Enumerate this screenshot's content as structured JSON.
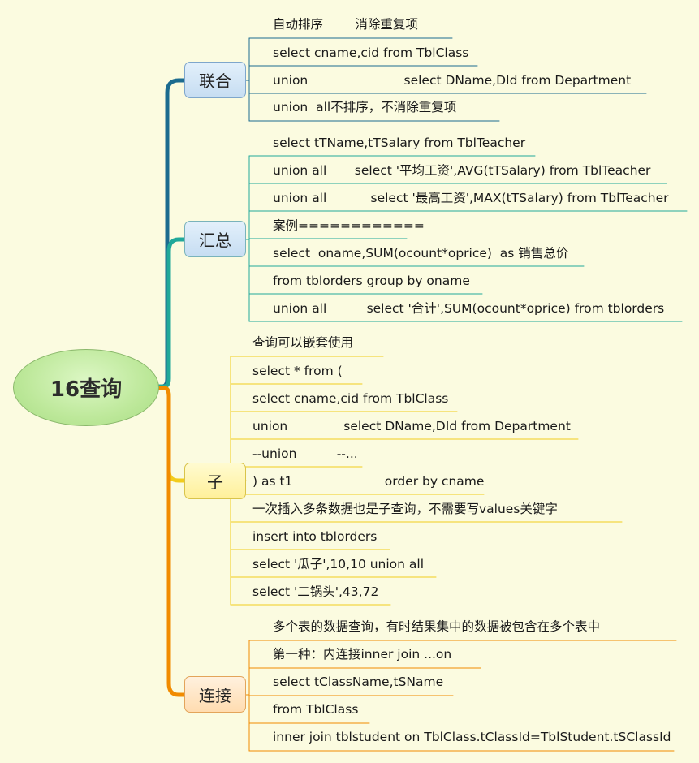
{
  "root": {
    "label": "16查询"
  },
  "colors": {
    "blue": "#1b6b8f",
    "teal": "#20a89a",
    "yellow": "#f2cc1c",
    "orange": "#f18b00"
  },
  "branches": [
    {
      "label": "联合",
      "items": [
        "自动排序        消除重复项",
        "select cname,cid from TblClass",
        "union                        select DName,DId from Department",
        "union  all不排序，不消除重复项"
      ]
    },
    {
      "label": "汇总",
      "items": [
        "select tTName,tTSalary from TblTeacher",
        "union all       select '平均工资',AVG(tTSalary) from TblTeacher",
        "union all           select '最高工资',MAX(tTSalary) from TblTeacher",
        "案例============",
        "select  oname,SUM(ocount*oprice)  as 销售总价",
        "from tblorders group by oname",
        "union all          select '合计',SUM(ocount*oprice) from tblorders"
      ]
    },
    {
      "label": "子",
      "items": [
        "查询可以嵌套使用",
        "select * from (",
        "select cname,cid from TblClass",
        "union              select DName,DId from Department",
        "--union          --...",
        ") as t1                       order by cname",
        "一次插入多条数据也是子查询，不需要写values关键字",
        "insert into tblorders",
        "select '瓜子',10,10 union all",
        "select '二锅头',43,72"
      ]
    },
    {
      "label": "连接",
      "items": [
        "多个表的数据查询，有时结果集中的数据被包含在多个表中",
        "第一种：内连接inner join ...on",
        "select tClassName,tSName",
        "from TblClass",
        "inner join tblstudent on TblClass.tClassId=TblStudent.tSClassId"
      ]
    }
  ]
}
